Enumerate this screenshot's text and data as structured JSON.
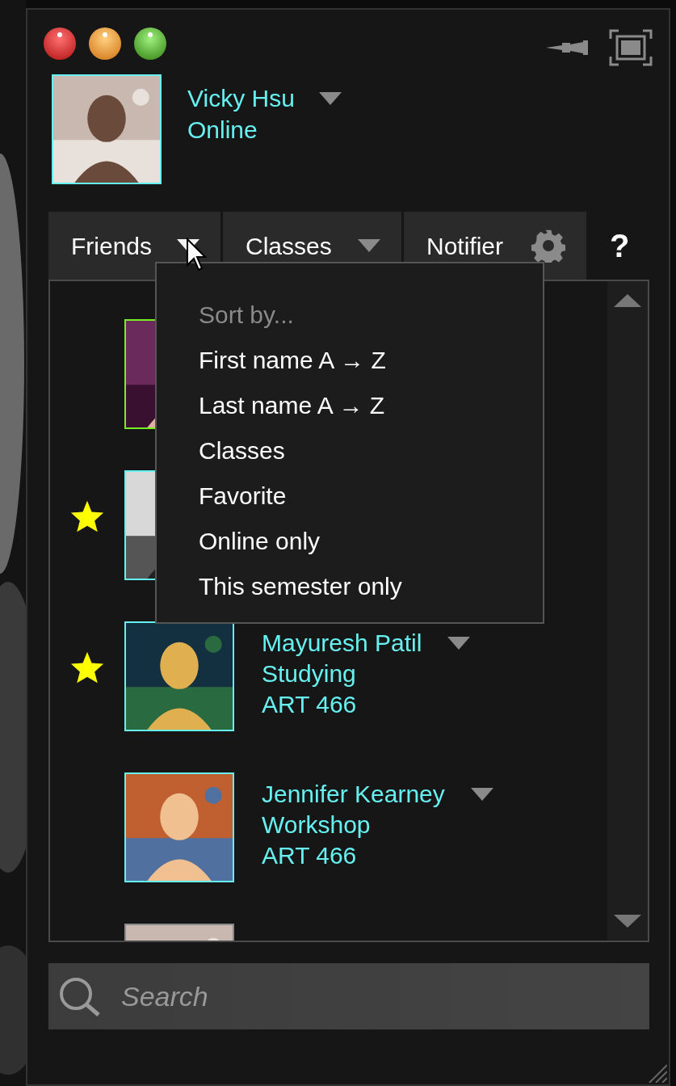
{
  "profile": {
    "name": "Vicky Hsu",
    "status": "Online"
  },
  "tabs": [
    {
      "label": "Friends",
      "expanded": true,
      "kind": "dropdown"
    },
    {
      "label": "Classes",
      "expanded": false,
      "kind": "dropdown"
    },
    {
      "label": "Notifier",
      "kind": "settings"
    }
  ],
  "help": "?",
  "sort_menu": {
    "title": "Sort by...",
    "items": [
      "First name A → Z",
      "Last name A → Z",
      "Classes",
      "Favorite",
      "Online only",
      "This semester only"
    ]
  },
  "contacts": [
    {
      "favorite": false,
      "color": "#77ee22"
    },
    {
      "favorite": true,
      "color": "#66f0f0"
    },
    {
      "name": "Mayuresh Patil",
      "status": "Studying",
      "class": "ART 466",
      "favorite": true,
      "color": "#66f0f0"
    },
    {
      "name": "Jennifer Kearney",
      "status": "Workshop",
      "class": "ART 466",
      "favorite": false,
      "color": "#66f0f0"
    },
    {
      "favorite": false,
      "color": "#8a8a8a"
    }
  ],
  "search": {
    "placeholder": "Search"
  }
}
